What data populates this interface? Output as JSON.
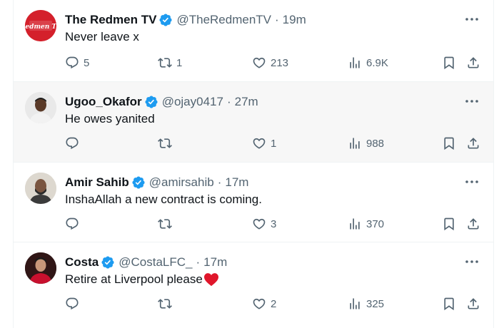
{
  "tweets": [
    {
      "name": "The Redmen TV",
      "handle": "@TheRedmenTV",
      "time": "19m",
      "text": "Never leave x",
      "replies": "5",
      "retweets": "1",
      "likes": "213",
      "views": "6.9K",
      "avatar": "redmen-logo",
      "avatar_label": "Redmen TV"
    },
    {
      "name": "Ugoo_Okafor",
      "handle": "@ojay0417",
      "time": "27m",
      "text": "He owes yanited",
      "replies": "",
      "retweets": "",
      "likes": "1",
      "views": "988",
      "avatar": "user-photo"
    },
    {
      "name": "Amir Sahib",
      "handle": "@amirsahib",
      "time": "17m",
      "text": "InshaAllah a new contract is coming.",
      "replies": "",
      "retweets": "",
      "likes": "3",
      "views": "370",
      "avatar": "user-photo"
    },
    {
      "name": "Costa",
      "handle": "@CostaLFC_",
      "time": "17m",
      "text": "Retire at Liverpool please",
      "replies": "",
      "retweets": "",
      "likes": "2",
      "views": "325",
      "avatar": "user-photo",
      "emoji": "red-heart"
    }
  ],
  "separator": "·",
  "colors": {
    "verified": "#1d9bf0",
    "muted": "#536471",
    "redmen_brand": "#d4202b",
    "heart_emoji": "#e0162b",
    "hover_bg": "#f7f7f7"
  }
}
